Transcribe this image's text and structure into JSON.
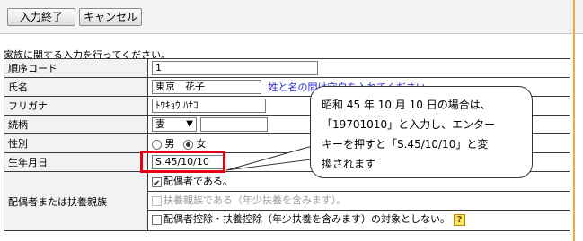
{
  "toolbar": {
    "finish_label": "入力終了",
    "cancel_label": "キャンセル"
  },
  "intro": "家族に関する入力を行ってください。",
  "rows": {
    "order_code": {
      "label": "順序コード",
      "value": "1"
    },
    "name": {
      "label": "氏名",
      "value": "東京　花子",
      "hint": "姓と名の間は空白を入れてください。"
    },
    "furigana": {
      "label": "フリガナ",
      "value": "ﾄｳｷｮｳ ﾊﾅｺ"
    },
    "relation": {
      "label": "続柄",
      "selected": "妻",
      "extra_value": ""
    },
    "gender": {
      "label": "性別",
      "options": [
        "男",
        "女"
      ],
      "selected": "女"
    },
    "birth": {
      "label": "生年月日",
      "value": "S.45/10/10"
    },
    "spouse": {
      "label": "配偶者または扶養親族",
      "is_spouse": "配偶者である。",
      "is_dependent": "扶養親族である（年少扶養を含みます）。",
      "no_deduction": "配偶者控除・扶養控除（年少扶養を含みます）の対象としない。"
    }
  },
  "callout": {
    "line1": "昭和 45 年 10 月 10 日の場合は、",
    "line2": "「19701010」と入力し、エンター",
    "line3": "キーを押すと「S.45/10/10」と変",
    "line4": "換されます"
  },
  "colors": {
    "highlight": "#e60012",
    "hint_text": "#2b2bd6",
    "label_bg": "#f2f2f2",
    "right_divider": "#f0a848"
  }
}
